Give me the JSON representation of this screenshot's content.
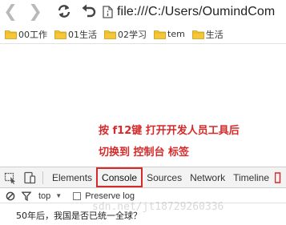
{
  "browser": {
    "url": "file:///C:/Users/OumindCom",
    "back_icon": "back-arrow-icon",
    "forward_icon": "forward-arrow-icon",
    "reload_icon": "reload-icon",
    "undo_icon": "undo-icon",
    "page_icon": "file-page-icon"
  },
  "bookmarks": [
    {
      "label": "00工作"
    },
    {
      "label": "01生活"
    },
    {
      "label": "02学习"
    },
    {
      "label": "tem"
    },
    {
      "label": "生活"
    }
  ],
  "annotation": {
    "line1": "按 f12键 打开开发人员工具后",
    "line2": "切换到 控制台 标签",
    "color": "#d42a2a"
  },
  "devtools": {
    "tabs": [
      {
        "label": "Elements"
      },
      {
        "label": "Console",
        "active": true
      },
      {
        "label": "Sources"
      },
      {
        "label": "Network"
      },
      {
        "label": "Timeline"
      }
    ],
    "context": "top",
    "preserve_log_label": "Preserve log",
    "preserve_log_checked": false
  },
  "console": {
    "output": "50年后，我国是否已统一全球？"
  },
  "watermark": "sdn.net/jt18729260336"
}
